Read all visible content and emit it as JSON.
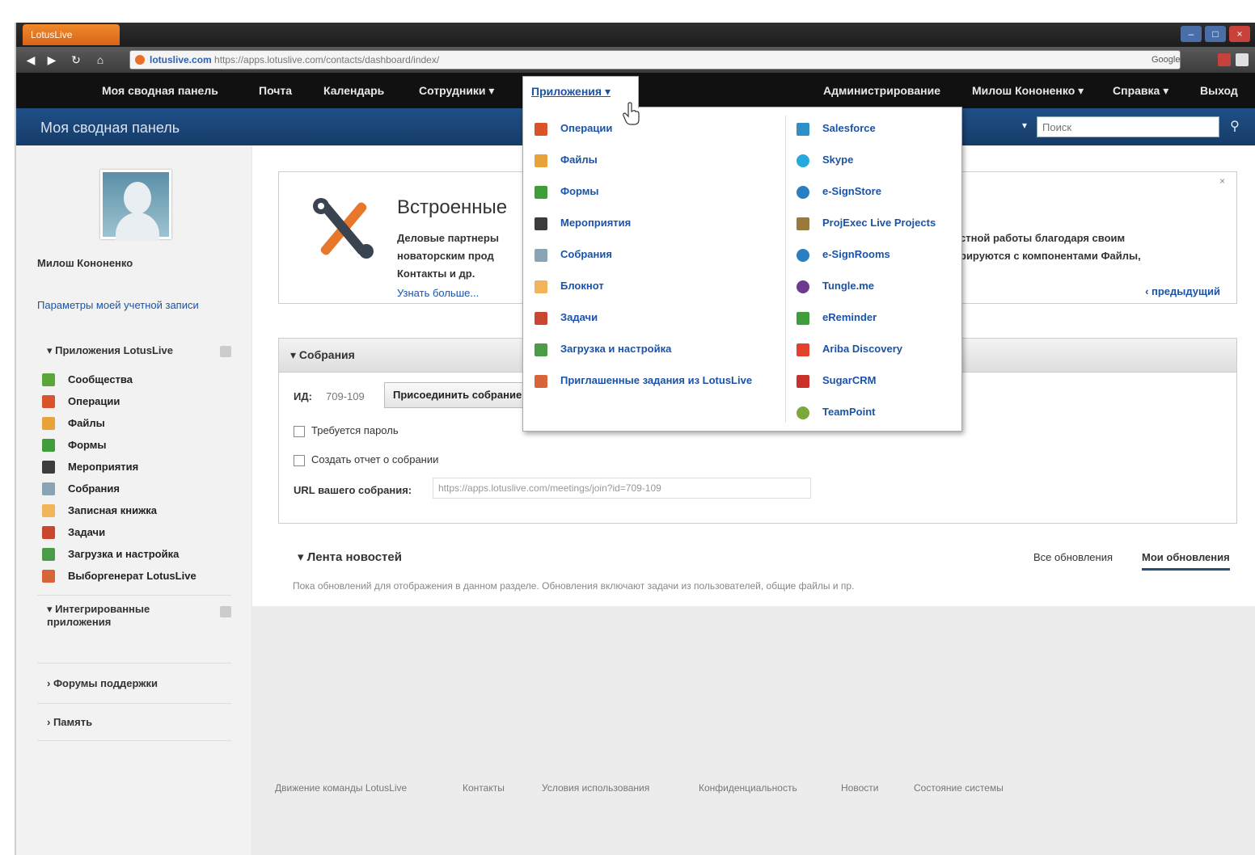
{
  "browser": {
    "tab_title": "LotusLive",
    "address_domain": "lotuslive.com",
    "address_path": " https://apps.lotuslive.com/contacts/dashboard/index/",
    "search_engine": "Google"
  },
  "topmenu": {
    "items": [
      "Моя сводная панель",
      "Почта",
      "Календарь",
      "Сотрудники ▾"
    ],
    "apps_label": "Приложения ▾",
    "right_items": [
      "Администрирование",
      "Милош Кононенко ▾",
      "Справка ▾",
      "Выход"
    ]
  },
  "appbar": {
    "title": "Моя сводная панель",
    "search_placeholder": "Поиск",
    "search_scope": "▾"
  },
  "sidebar": {
    "user_name": "Милош Кононенко",
    "account_link": "Параметры моей учетной записи",
    "apps_section": "▾ Приложения LotusLive",
    "apps_items": [
      {
        "label": "Сообщества",
        "color": "#5aa63b"
      },
      {
        "label": "Операции",
        "color": "#d9532c"
      },
      {
        "label": "Файлы",
        "color": "#e8a23a"
      },
      {
        "label": "Формы",
        "color": "#3f9d3a"
      },
      {
        "label": "Мероприятия",
        "color": "#3c3c3c"
      },
      {
        "label": "Собрания",
        "color": "#8aa4b4"
      },
      {
        "label": "Записная книжка",
        "color": "#f0b45a"
      },
      {
        "label": "Задачи",
        "color": "#c9472f"
      },
      {
        "label": "Загрузка и настройка",
        "color": "#4c9b48"
      },
      {
        "label": "Выборгенерат LotusLive",
        "color": "#d8643a"
      }
    ],
    "integrated_section": "▾ Интегрированные приложения",
    "forums_section": "› Форумы поддержки",
    "memory_section": "› Память"
  },
  "builtin_card": {
    "title": "Встроенные",
    "line1_left": "Деловые партнеры",
    "line1_right": "стной работы благодаря своим",
    "line2_left": "новаторским прод",
    "line2_right": "рируются с компонентами Файлы,",
    "line3_left": "Контакты и др.",
    "more_link": "Узнать больше...",
    "prev_link": "‹ предыдущий",
    "close": "×"
  },
  "meeting_card": {
    "header": "▾ Собрания",
    "id_label": "ИД:",
    "id_value": "709-109",
    "join_button": "Присоединить собрание",
    "require_password": "Требуется пароль",
    "create_report": "Создать отчет о собрании",
    "url_label": "URL вашего собрания:",
    "url_value": "https://apps.lotuslive.com/meetings/join?id=709-109"
  },
  "news": {
    "title": "▾ Лента новостей",
    "tab_all": "Все обновления",
    "tab_mine": "Мои обновления",
    "empty_text": "Пока обновлений для отображения в данном разделе. Обновления включают задачи из пользователей, общие файлы и пр."
  },
  "footer": {
    "links": [
      "Движение команды LotusLive",
      "Контакты",
      "Условия использования",
      "Конфиденциальность",
      "Новости",
      "Состояние системы"
    ]
  },
  "apps_dropdown": {
    "left": [
      {
        "label": "Операции",
        "color": "#d9532c"
      },
      {
        "label": "Файлы",
        "color": "#e8a23a"
      },
      {
        "label": "Формы",
        "color": "#3f9d3a"
      },
      {
        "label": "Мероприятия",
        "color": "#3c3c3c"
      },
      {
        "label": "Собрания",
        "color": "#8aa4b4"
      },
      {
        "label": "Блокнот",
        "color": "#f0b45a"
      },
      {
        "label": "Задачи",
        "color": "#c9472f"
      },
      {
        "label": "Загрузка и настройка",
        "color": "#4c9b48"
      },
      {
        "label": "Приглашенные задания из LotusLive",
        "color": "#d8643a"
      }
    ],
    "right": [
      {
        "label": "Salesforce",
        "color": "#2f8fc8"
      },
      {
        "label": "Skype",
        "color": "#27a9e0"
      },
      {
        "label": "e-SignStore",
        "color": "#2a7fc0"
      },
      {
        "label": "ProjExec Live Projects",
        "color": "#9a7a3a"
      },
      {
        "label": "e-SignRooms",
        "color": "#2a7fc0"
      },
      {
        "label": "Tungle.me",
        "color": "#6c3b8f"
      },
      {
        "label": "eReminder",
        "color": "#3f9d3a"
      },
      {
        "label": "Ariba Discovery",
        "color": "#e2412e"
      },
      {
        "label": "SugarCRM",
        "color": "#c9302c"
      },
      {
        "label": "TeamPoint",
        "color": "#7aa83b"
      }
    ]
  }
}
